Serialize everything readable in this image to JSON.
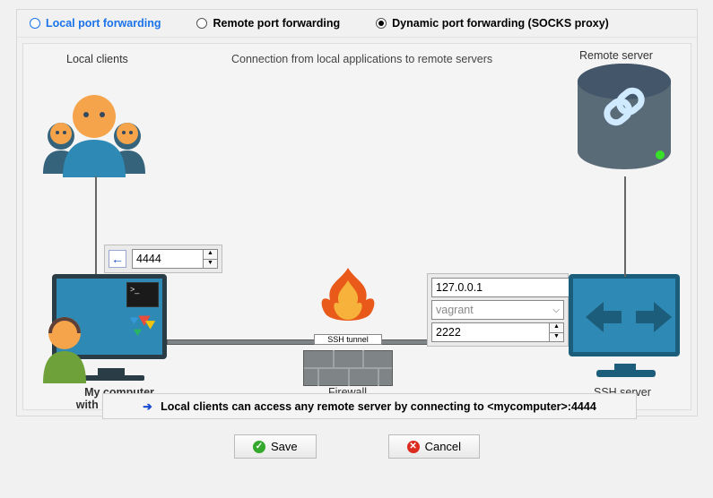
{
  "tabs": {
    "local": {
      "label": "Local port forwarding",
      "checked": false
    },
    "remote": {
      "label": "Remote port forwarding",
      "checked": false
    },
    "dynamic": {
      "label": "Dynamic port forwarding (SOCKS proxy)",
      "checked": true
    }
  },
  "diagram": {
    "subtitle": "Connection from local applications to remote servers",
    "local_clients_label": "Local clients",
    "remote_server_label": "Remote server",
    "my_computer_label_line1": "My computer",
    "my_computer_label_line2": "with MobaXterm",
    "firewall_label": "Firewall",
    "ssh_tunnel_label": "SSH tunnel",
    "ssh_server_label": "SSH server"
  },
  "fields": {
    "local_port": "4444",
    "ssh_host": "127.0.0.1",
    "ssh_user": "vagrant",
    "ssh_port": "2222"
  },
  "summary": {
    "text": "Local clients can access any remote server by connecting to <mycomputer>:4444"
  },
  "buttons": {
    "save": "Save",
    "cancel": "Cancel"
  }
}
